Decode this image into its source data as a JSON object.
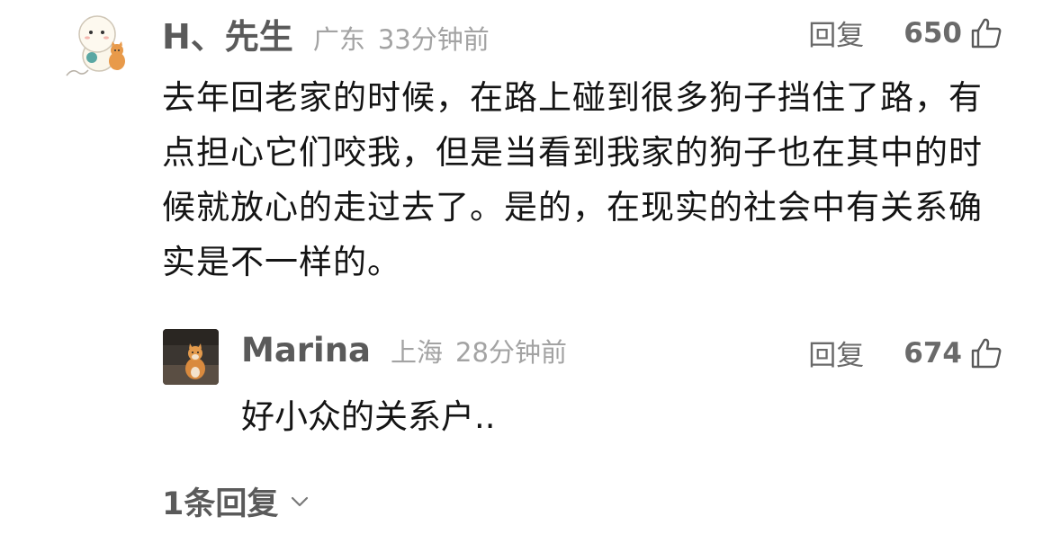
{
  "comment": {
    "username": "H、先生",
    "location": "广东",
    "time": "33分钟前",
    "reply_label": "回复",
    "like_count": "650",
    "body": "去年回老家的时候，在路上碰到很多狗子挡住了路，有点担心它们咬我，但是当看到我家的狗子也在其中的时候就放心的走过去了。是的，在现实的社会中有关系确实是不一样的。",
    "avatar_icon": "cartoon-character-avatar",
    "like_icon": "thumbs-up-icon"
  },
  "reply": {
    "username": "Marina",
    "location": "上海",
    "time": "28分钟前",
    "reply_label": "回复",
    "like_count": "674",
    "body": "好小众的关系户..",
    "avatar_icon": "cat-photo-avatar",
    "like_icon": "thumbs-up-icon"
  },
  "more_replies": {
    "label": "1条回复",
    "icon": "chevron-down-icon"
  },
  "colors": {
    "username": "#5a5a5a",
    "meta": "#a3a3a3",
    "body": "#141414",
    "background": "#ffffff"
  }
}
